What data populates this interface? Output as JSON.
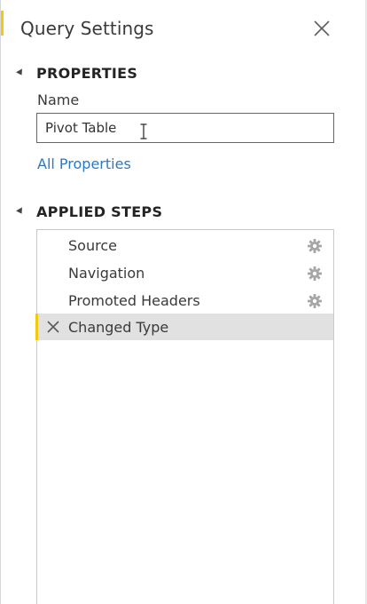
{
  "header": {
    "title": "Query Settings"
  },
  "properties": {
    "section_label": "PROPERTIES",
    "name_label": "Name",
    "name_value": "Pivot Table",
    "all_properties_link": "All Properties"
  },
  "applied_steps": {
    "section_label": "APPLIED STEPS",
    "steps": [
      {
        "label": "Source",
        "has_settings": true,
        "selected": false
      },
      {
        "label": "Navigation",
        "has_settings": true,
        "selected": false
      },
      {
        "label": "Promoted Headers",
        "has_settings": true,
        "selected": false
      },
      {
        "label": "Changed Type",
        "has_settings": false,
        "selected": true
      }
    ]
  },
  "colors": {
    "accent_yellow": "#f2c811",
    "link_blue": "#2b78c5",
    "selected_row": "#e1e1e1"
  },
  "icons": {
    "close": "close-icon",
    "collapse": "triangle-collapse-icon",
    "settings": "gear-icon",
    "delete": "delete-x-icon",
    "text_cursor": "ibeam-cursor-icon"
  }
}
